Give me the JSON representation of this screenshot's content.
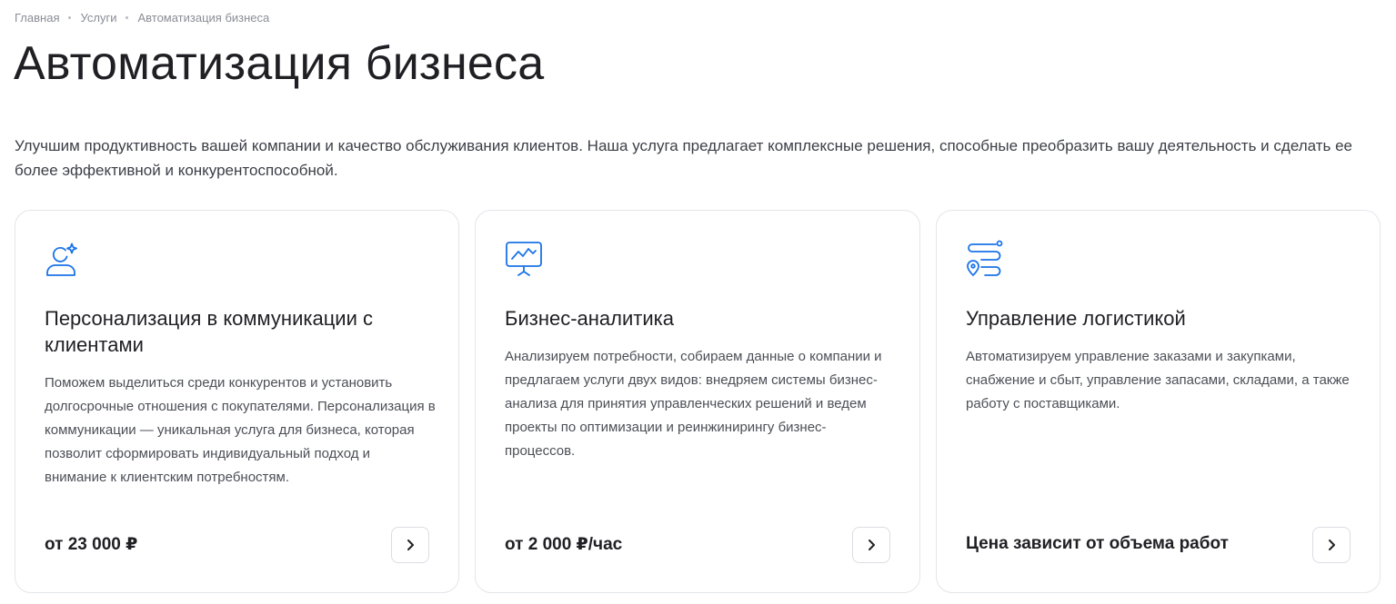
{
  "breadcrumb": {
    "items": [
      "Главная",
      "Услуги",
      "Автоматизация бизнеса"
    ]
  },
  "page": {
    "title": "Автоматизация бизнеса",
    "intro": "Улучшим продуктивность вашей компании и качество обслуживания клиентов. Наша услуга предлагает комплексные решения, способные преобразить вашу деятельность и сделать ее более эффективной и конкурентоспособной."
  },
  "colors": {
    "accent": "#1a73e8",
    "text": "#1f1f24",
    "border": "#e3e5ea"
  },
  "cards": [
    {
      "icon": "person-sparkle-icon",
      "title": "Персонализация в коммуникации с клиентами",
      "description": "Поможем выделиться среди конкурентов и установить долгосрочные отношения с покупателями. Персонализация в коммуникации — уникальная услуга для бизнеса, которая позволит сформировать индивидуальный подход и внимание к клиентским потребностям.",
      "price": "от 23 000 ₽"
    },
    {
      "icon": "analytics-chart-icon",
      "title": "Бизнес-аналитика",
      "description": "Анализируем потребности, собираем данные о компании и предлагаем услуги двух видов: внедряем системы бизнес-анализа для принятия управленческих решений и ведем проекты по оптимизации и реинжинирингу бизнес-процессов.",
      "price": "от 2 000 ₽/час"
    },
    {
      "icon": "logistics-route-icon",
      "title": "Управление логистикой",
      "description": "Автоматизируем управление заказами и закупками, снабжение и сбыт, управление запасами, складами, а также работу с поставщиками.",
      "price": "Цена зависит от объема работ"
    }
  ]
}
